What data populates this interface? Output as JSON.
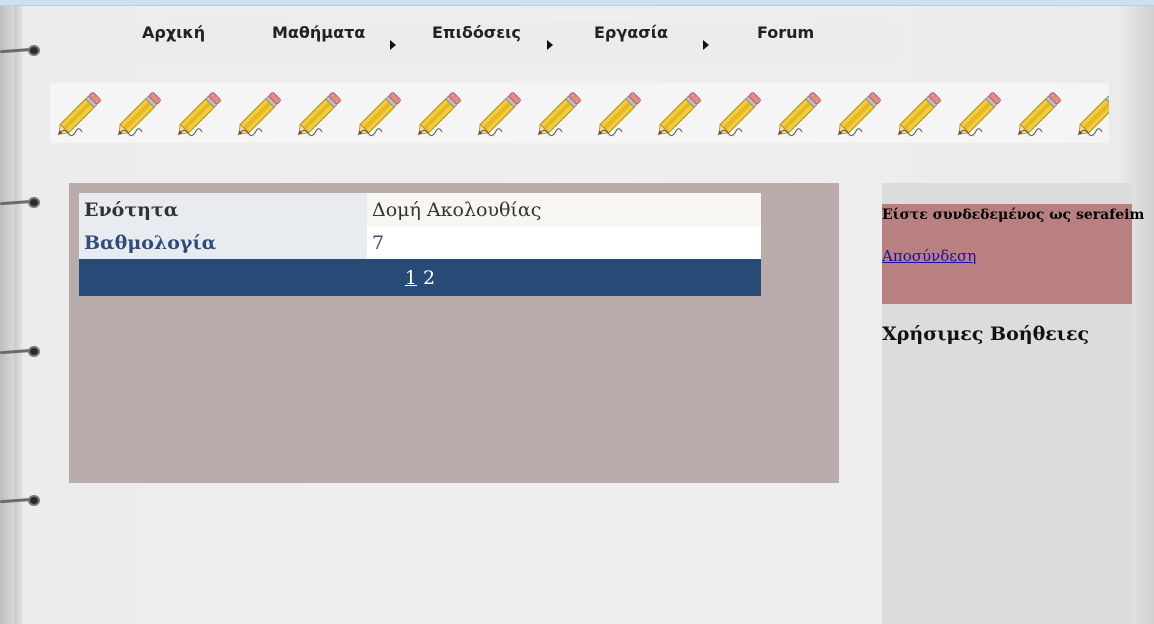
{
  "nav": {
    "items": [
      {
        "label": "Αρχική",
        "has_submenu": false
      },
      {
        "label": "Μαθήματα",
        "has_submenu": true
      },
      {
        "label": "Επιδόσεις",
        "has_submenu": true
      },
      {
        "label": "Εργασία",
        "has_submenu": true
      },
      {
        "label": "Forum",
        "has_submenu": false
      }
    ]
  },
  "banner": {
    "icon": "pencil-icon",
    "count": 18
  },
  "result_table": {
    "rows": [
      {
        "header": "Ενότητα",
        "value": "Δομή Ακολουθίας"
      },
      {
        "header": "Βαθμολογία",
        "value": "7"
      }
    ],
    "pager": {
      "current": "1",
      "pages": [
        "1",
        "2"
      ]
    }
  },
  "sidebar": {
    "login_status": "Είστε συνδεδεμένος ως serafeim",
    "logout_link": "Αποσύνδεση",
    "help_title": "Χρήσιμες Βοήθειες"
  },
  "colors": {
    "nav_bg": "#ececec",
    "content_bg": "#baacaa",
    "pager_bg": "#284a76",
    "login_box_bg": "#b88080",
    "sidebar_bg": "#dcdcdc"
  }
}
